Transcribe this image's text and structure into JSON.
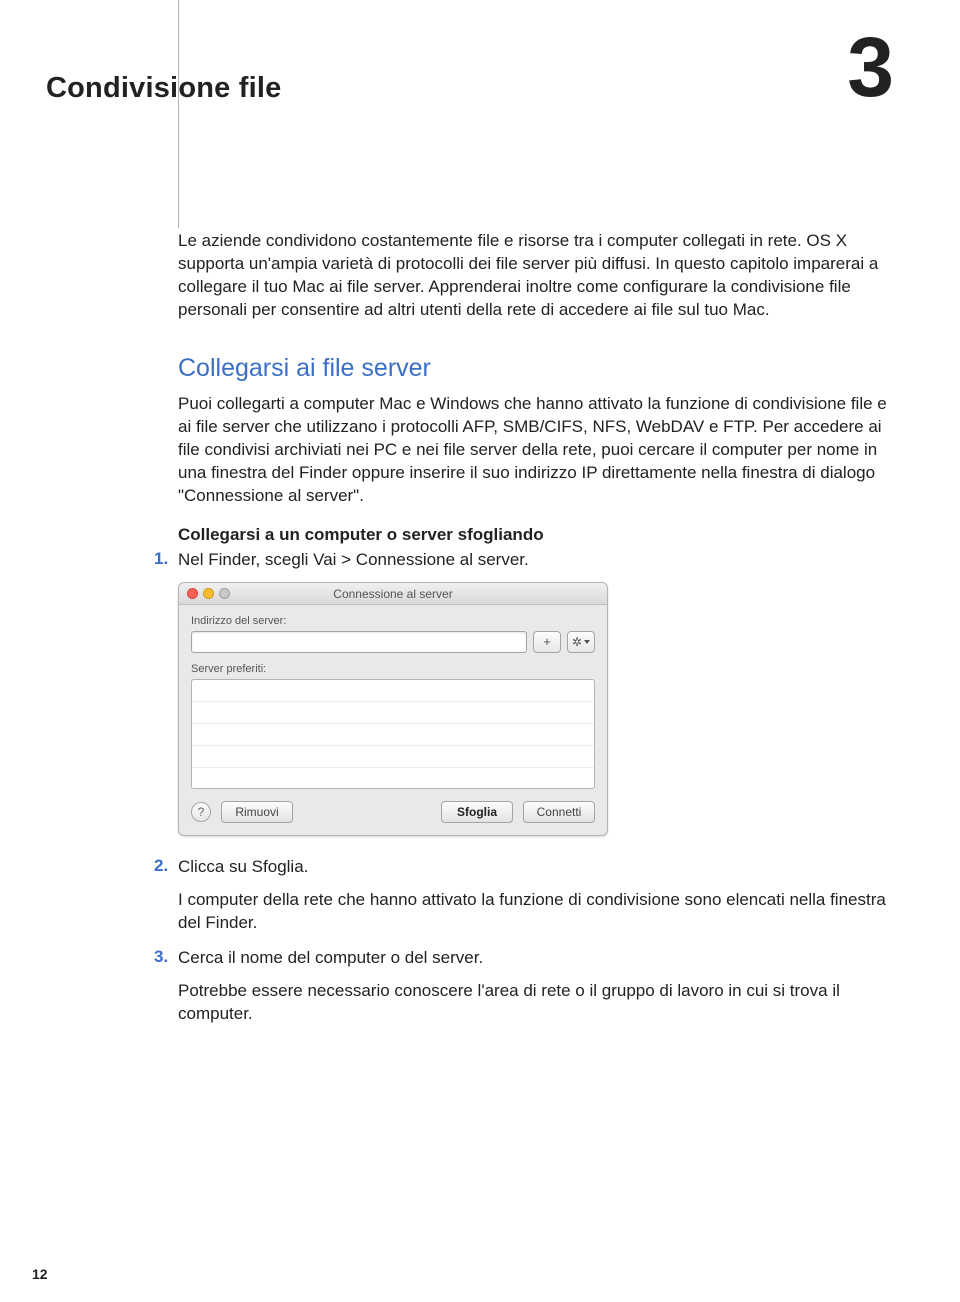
{
  "chapter": {
    "title": "Condivisione file",
    "number": "3"
  },
  "intro": "Le aziende condividono costantemente file e risorse tra i computer collegati in rete. OS X supporta un'ampia varietà di protocolli dei file server più diffusi. In questo capitolo imparerai a collegare il tuo Mac ai file server. Apprenderai inoltre come configurare la condivisione file personali per consentire ad altri utenti della rete di accedere ai file sul tuo Mac.",
  "section": {
    "title": "Collegarsi ai file server",
    "body": "Puoi collegarti a computer Mac e Windows che hanno attivato la funzione di condivisione file e ai file server che utilizzano i protocolli AFP, SMB/CIFS, NFS, WebDAV e FTP. Per accedere ai file condivisi archiviati nei PC e nei file server della rete, puoi cercare il computer per nome in una finestra del Finder oppure inserire il suo indirizzo IP direttamente nella finestra di dialogo \"Connessione al server\".",
    "subhead": "Collegarsi a un computer o server sfogliando"
  },
  "steps": {
    "s1": {
      "num": "1.",
      "text": "Nel Finder, scegli Vai > Connessione al server."
    },
    "s2": {
      "num": "2.",
      "text": "Clicca su Sfoglia.",
      "para": "I computer della rete che hanno attivato la funzione di condivisione sono elencati nella finestra del Finder."
    },
    "s3": {
      "num": "3.",
      "text": "Cerca il nome del computer o del server.",
      "para": "Potrebbe essere necessario conoscere l'area di rete o il gruppo di lavoro in cui si trova il computer."
    }
  },
  "dialog": {
    "title": "Connessione al server",
    "addr_label": "Indirizzo del server:",
    "fav_label": "Server preferiti:",
    "plus": "+",
    "gear": "✲",
    "help": "?",
    "remove": "Rimuovi",
    "browse": "Sfoglia",
    "connect": "Connetti"
  },
  "page_number": "12"
}
